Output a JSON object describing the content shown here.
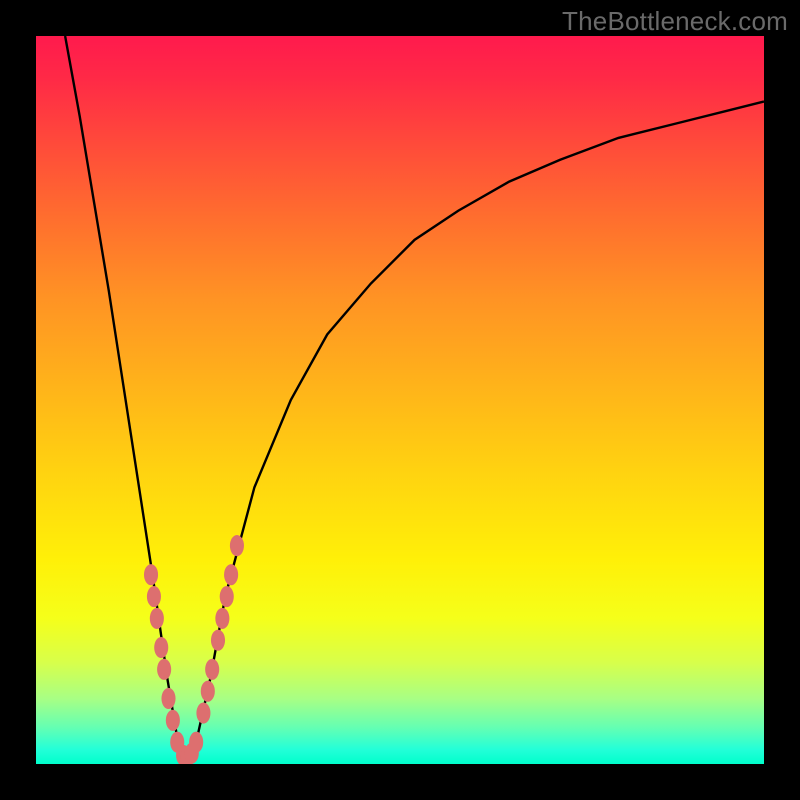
{
  "watermark": "TheBottleneck.com",
  "colors": {
    "frame": "#000000",
    "gradient_top": "#ff1a4d",
    "gradient_bottom": "#00ffcc",
    "curve": "#000000",
    "marker": "#dd6f6f"
  },
  "chart_data": {
    "type": "line",
    "title": "",
    "xlabel": "",
    "ylabel": "",
    "xlim": [
      0,
      100
    ],
    "ylim": [
      0,
      100
    ],
    "grid": false,
    "series": [
      {
        "name": "curve",
        "x": [
          4,
          6,
          8,
          10,
          12,
          14,
          16,
          18,
          19.5,
          20.5,
          22,
          24,
          26,
          30,
          35,
          40,
          46,
          52,
          58,
          65,
          72,
          80,
          88,
          96,
          100
        ],
        "y": [
          100,
          89,
          77,
          65,
          52,
          39,
          26,
          12,
          3,
          0.5,
          3,
          12,
          23,
          38,
          50,
          59,
          66,
          72,
          76,
          80,
          83,
          86,
          88,
          90,
          91
        ]
      }
    ],
    "markers": [
      {
        "x": 15.8,
        "y": 26,
        "r": 2.2
      },
      {
        "x": 16.2,
        "y": 23,
        "r": 2.2
      },
      {
        "x": 16.6,
        "y": 20,
        "r": 2.2
      },
      {
        "x": 17.2,
        "y": 16,
        "r": 2.2
      },
      {
        "x": 17.6,
        "y": 13,
        "r": 2.2
      },
      {
        "x": 18.2,
        "y": 9,
        "r": 2.2
      },
      {
        "x": 18.8,
        "y": 6,
        "r": 2.2
      },
      {
        "x": 19.4,
        "y": 3,
        "r": 2.2
      },
      {
        "x": 20.2,
        "y": 1.2,
        "r": 2.2
      },
      {
        "x": 20.8,
        "y": 1.0,
        "r": 2.2
      },
      {
        "x": 21.4,
        "y": 1.5,
        "r": 2.2
      },
      {
        "x": 22.0,
        "y": 3,
        "r": 2.2
      },
      {
        "x": 25.0,
        "y": 17,
        "r": 2.2
      },
      {
        "x": 25.6,
        "y": 20,
        "r": 2.2
      },
      {
        "x": 26.2,
        "y": 23,
        "r": 2.2
      },
      {
        "x": 26.8,
        "y": 26,
        "r": 2.2
      },
      {
        "x": 27.6,
        "y": 30,
        "r": 2.2
      },
      {
        "x": 23.0,
        "y": 7,
        "r": 2.2
      },
      {
        "x": 23.6,
        "y": 10,
        "r": 2.2
      },
      {
        "x": 24.2,
        "y": 13,
        "r": 2.2
      }
    ]
  }
}
